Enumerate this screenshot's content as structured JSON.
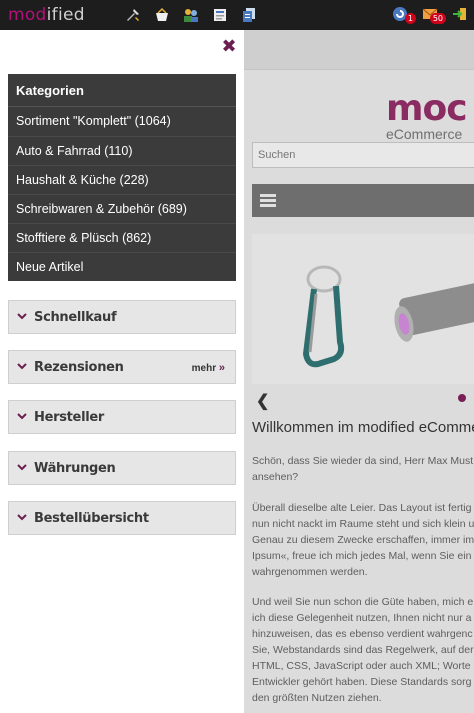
{
  "adminbar": {
    "logo_mod": "mod",
    "logo_ified": "ified",
    "icons": [
      "tools-icon",
      "basket-icon",
      "users-icon",
      "content-icon",
      "pages-icon"
    ],
    "right_icons": [
      {
        "name": "orders-icon",
        "badge": "1"
      },
      {
        "name": "mail-icon",
        "badge": "50"
      },
      {
        "name": "logout-icon",
        "badge": ""
      }
    ]
  },
  "sidebar": {
    "close_label": "✖",
    "categories": {
      "title": "Kategorien",
      "items": [
        "Sortiment \"Komplett\" (1064)",
        "Auto & Fahrrad (110)",
        "Haushalt & Küche (228)",
        "Schreibwaren & Zubehör (689)",
        "Stofftiere & Plüsch (862)",
        "Neue Artikel"
      ]
    },
    "boxes": [
      {
        "label": "Schnellkauf",
        "more": ""
      },
      {
        "label": "Rezensionen",
        "more": "mehr"
      },
      {
        "label": "Hersteller",
        "more": ""
      },
      {
        "label": "Währungen",
        "more": ""
      },
      {
        "label": "Bestellübersicht",
        "more": ""
      }
    ],
    "more_arrow": "»"
  },
  "site": {
    "brand": "moc",
    "brand_sub": "eCommerce",
    "search_placeholder": "Suchen",
    "heading": "Willkommen im modified eCommerce S",
    "paragraphs": [
      [
        "Schön, dass Sie wieder da sind, Herr Max Must",
        "ansehen?"
      ],
      [
        "Überall dieselbe alte Leier. Das Layout ist fertig",
        "nun nicht nackt im Raume steht und sich klein u",
        "Genau zu diesem Zwecke erschaffen, immer im",
        "Ipsum«, freue ich mich jedes Mal, wenn Sie ein",
        "wahrgenommen werden."
      ],
      [
        "Und weil Sie nun schon die Güte haben, mich e",
        "ich diese Gelegenheit nutzen, Ihnen nicht nur a",
        "hinzuweisen, das es ebenso verdient wahrgenc",
        "Sie, Webstandards sind das Regelwerk, auf der",
        "HTML, CSS, JavaScript oder auch XML; Worte",
        "Entwickler gehört haben. Diese Standards sorg",
        "den größten Nutzen ziehen."
      ]
    ]
  },
  "colors": {
    "accent": "#6b1e50",
    "adminbar_bg": "#1d1d1d",
    "category_bg": "#3b3b3b",
    "box_bg": "#e6e6e6"
  }
}
